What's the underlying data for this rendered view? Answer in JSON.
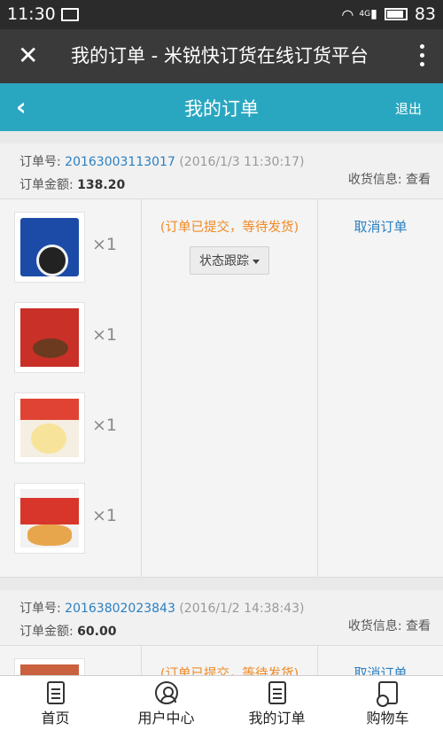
{
  "status_bar": {
    "time": "11:30",
    "signal_label": "4G",
    "battery": "83"
  },
  "browser": {
    "title": "我的订单 - 米锐快订货在线订货平台"
  },
  "app_bar": {
    "title": "我的订单",
    "logout": "退出"
  },
  "labels": {
    "order_no": "订单号:",
    "amount": "订单金额:",
    "shipping": "收货信息:",
    "view": "查看",
    "qty_prefix": "×",
    "track": "状态跟踪",
    "cancel": "取消订单"
  },
  "orders": [
    {
      "number": "20163003113017",
      "date": "(2016/1/3 11:30:17)",
      "amount": "138.20",
      "status": "(订单已提交，等待发货)",
      "items": [
        {
          "image": "oreo-biscuit-pack",
          "qty": "1"
        },
        {
          "image": "orion-choco-pie-box",
          "qty": "1"
        },
        {
          "image": "steamed-bun-box",
          "qty": "1"
        },
        {
          "image": "snack-cake-box",
          "qty": "1"
        }
      ]
    },
    {
      "number": "20163802023843",
      "date": "(2016/1/2 14:38:43)",
      "amount": "60.00",
      "status": "(订单已提交，等待发货)",
      "items": [
        {
          "image": "braised-food-dish",
          "qty": "1"
        }
      ]
    }
  ],
  "tabs": [
    {
      "label": "首页",
      "icon": "document-icon"
    },
    {
      "label": "用户中心",
      "icon": "user-icon"
    },
    {
      "label": "我的订单",
      "icon": "order-icon"
    },
    {
      "label": "购物车",
      "icon": "cart-icon"
    }
  ]
}
